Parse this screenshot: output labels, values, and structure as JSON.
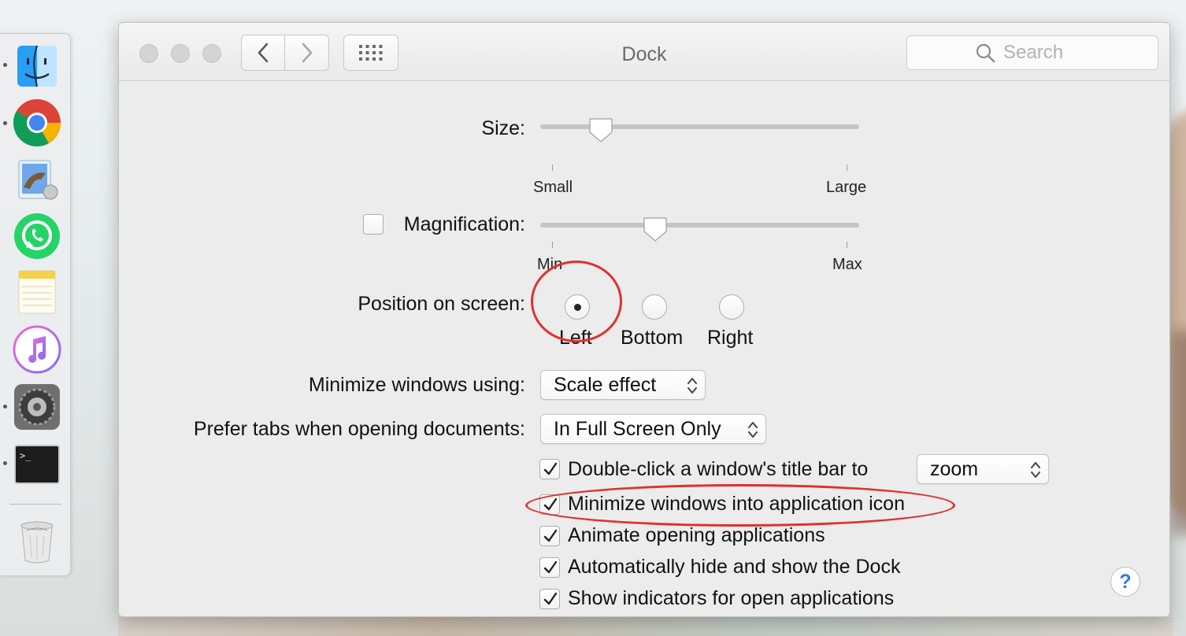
{
  "window": {
    "title": "Dock",
    "search_placeholder": "Search"
  },
  "dock": {
    "apps": [
      "Finder",
      "Google Chrome",
      "Mail",
      "WhatsApp",
      "Notes",
      "iTunes",
      "System Preferences",
      "Terminal",
      "Trash"
    ]
  },
  "size": {
    "label": "Size:",
    "min_label": "Small",
    "max_label": "Large",
    "value": 0.19
  },
  "magnification": {
    "label": "Magnification:",
    "checked": false,
    "min_label": "Min",
    "max_label": "Max",
    "value": 0.36
  },
  "position": {
    "label": "Position on screen:",
    "options": [
      "Left",
      "Bottom",
      "Right"
    ],
    "selected": "Left"
  },
  "minimize_using": {
    "label": "Minimize windows using:",
    "value": "Scale effect"
  },
  "prefer_tabs": {
    "label": "Prefer tabs when opening documents:",
    "value": "In Full Screen Only"
  },
  "options": {
    "double_click": {
      "label": "Double-click a window's title bar to",
      "checked": true,
      "action": "zoom"
    },
    "minimize_into_icon": {
      "label": "Minimize windows into application icon",
      "checked": true
    },
    "animate": {
      "label": "Animate opening applications",
      "checked": true
    },
    "autohide": {
      "label": "Automatically hide and show the Dock",
      "checked": true
    },
    "indicators": {
      "label": "Show indicators for open applications",
      "checked": true
    }
  },
  "help": {
    "label": "?"
  },
  "colors": {
    "annotation": "#e0312d",
    "help_blue": "#2f7de1"
  }
}
